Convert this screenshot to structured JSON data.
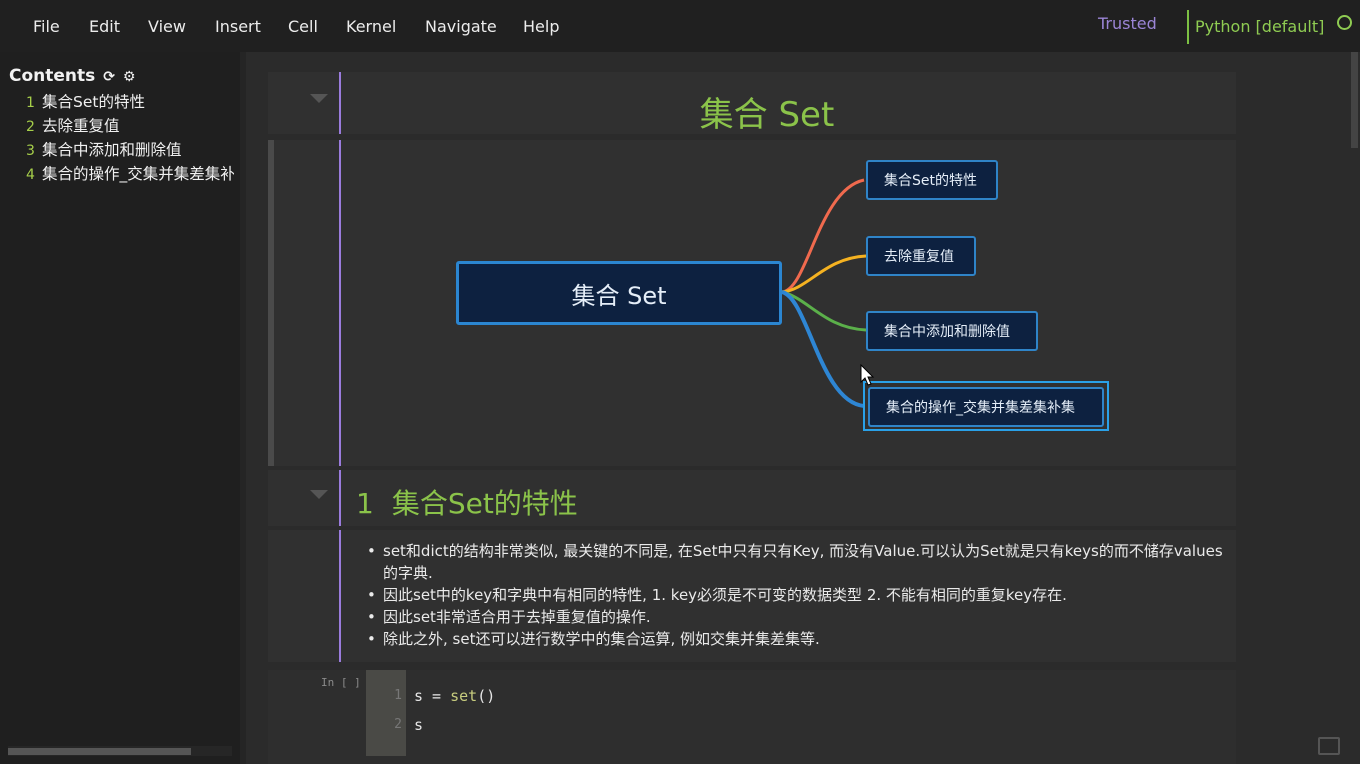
{
  "menu": [
    "File",
    "Edit",
    "View",
    "Insert",
    "Cell",
    "Kernel",
    "Navigate",
    "Help"
  ],
  "status": {
    "trusted": "Trusted",
    "kernel": "Python [default]"
  },
  "toc": {
    "title": "Contents",
    "items": [
      {
        "num": "1",
        "label": "集合Set的特性"
      },
      {
        "num": "2",
        "label": "去除重复值"
      },
      {
        "num": "3",
        "label": "集合中添加和删除值"
      },
      {
        "num": "4",
        "label": "集合的操作_交集并集差集补集"
      }
    ]
  },
  "title_cell": {
    "text": "集合 Set"
  },
  "mindmap": {
    "root": "集合 Set",
    "branches": [
      {
        "label": "集合Set的特性",
        "color": "#f06a4e"
      },
      {
        "label": "去除重复值",
        "color": "#f5b221"
      },
      {
        "label": "集合中添加和删除值",
        "color": "#5bb04a"
      },
      {
        "label": "集合的操作_交集并集差集补集",
        "color": "#2e86d4"
      }
    ]
  },
  "section1": {
    "num": "1",
    "heading": "集合Set的特性",
    "bullets": [
      "set和dict的结构非常类似, 最关键的不同是, 在Set中只有只有Key, 而没有Value.可以认为Set就是只有keys的而不储存values的字典.",
      "因此set中的key和字典中有相同的特性, 1. key必须是不可变的数据类型 2. 不能有相同的重复key存在.",
      "因此set非常适合用于去掉重复值的操作.",
      "除此之外, set还可以进行数学中的集合运算, 例如交集并集差集等."
    ]
  },
  "code_cell": {
    "prompt": "In [ ]",
    "line1_var": "s",
    "line1_op": " = ",
    "line1_fn": "set",
    "line1_paren": "()",
    "line2": "s",
    "ln1": "1",
    "ln2": "2"
  }
}
